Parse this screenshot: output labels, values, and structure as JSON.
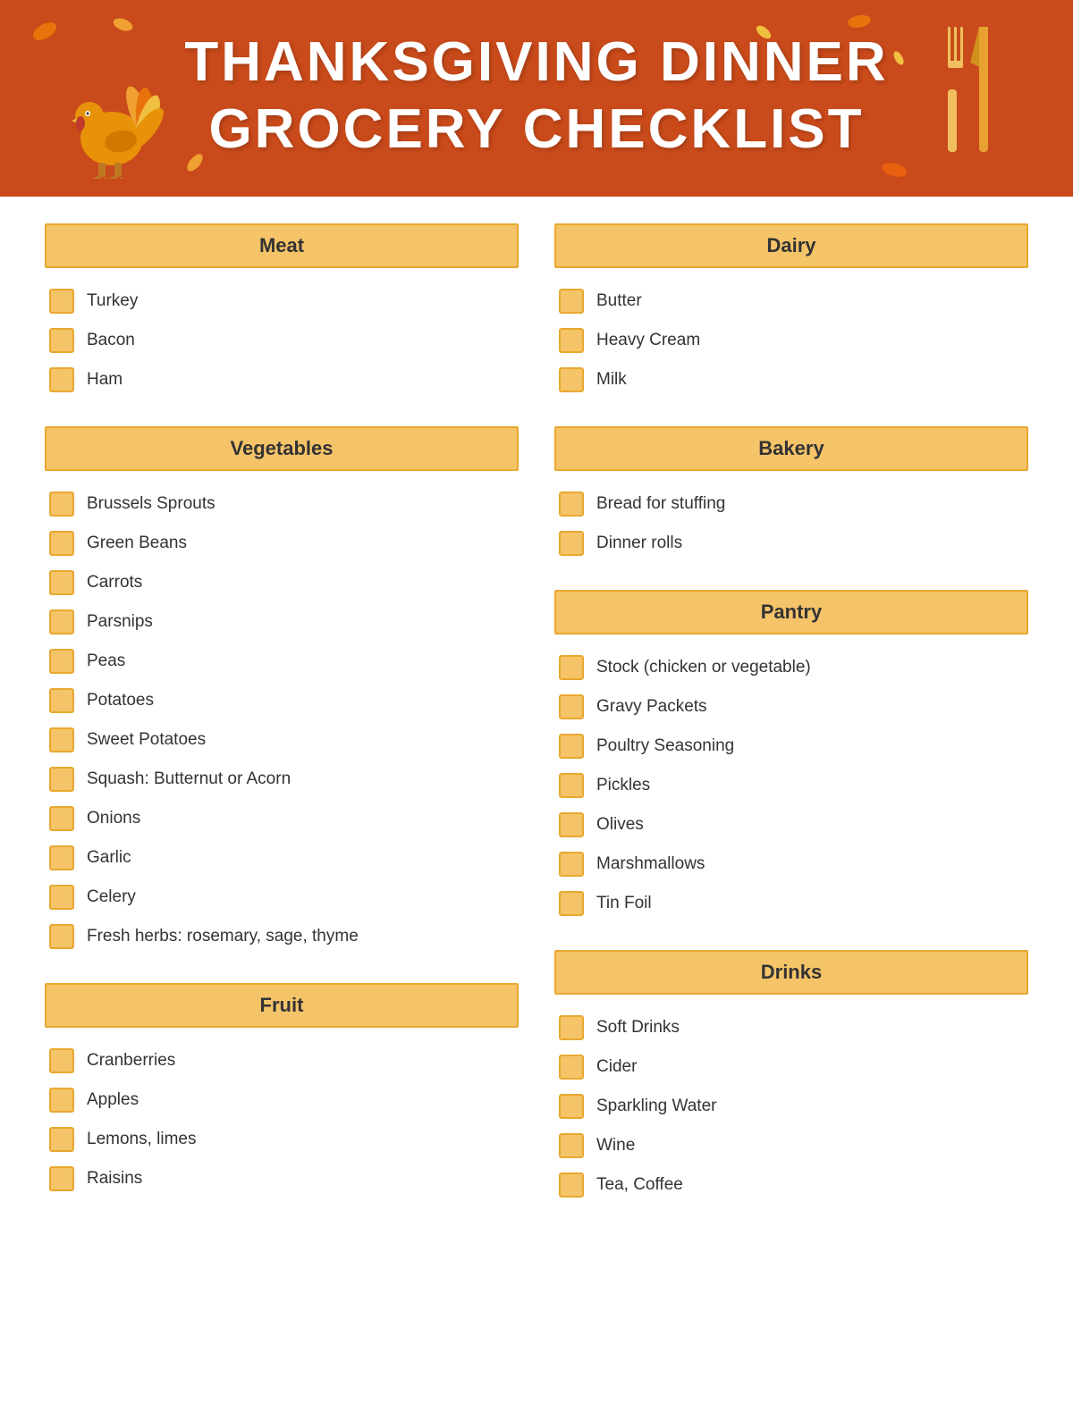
{
  "header": {
    "title_line1": "THANKSGIVING DINNER",
    "title_line2": "GROCERY CHECKLIST",
    "accent_color": "#c94a1a",
    "text_color": "#ffffff"
  },
  "sections": {
    "meat": {
      "label": "Meat",
      "items": [
        "Turkey",
        "Bacon",
        "Ham"
      ]
    },
    "dairy": {
      "label": "Dairy",
      "items": [
        "Butter",
        "Heavy Cream",
        "Milk"
      ]
    },
    "vegetables": {
      "label": "Vegetables",
      "items": [
        "Brussels Sprouts",
        "Green Beans",
        "Carrots",
        "Parsnips",
        "Peas",
        "Potatoes",
        "Sweet Potatoes",
        "Squash: Butternut or Acorn",
        "Onions",
        "Garlic",
        "Celery",
        "Fresh herbs: rosemary, sage, thyme"
      ]
    },
    "bakery": {
      "label": "Bakery",
      "items": [
        "Bread for stuffing",
        "Dinner rolls"
      ]
    },
    "pantry": {
      "label": "Pantry",
      "items": [
        "Stock (chicken or vegetable)",
        "Gravy Packets",
        "Poultry Seasoning",
        "Pickles",
        "Olives",
        "Marshmallows",
        "Tin Foil"
      ]
    },
    "fruit": {
      "label": "Fruit",
      "items": [
        "Cranberries",
        "Apples",
        "Lemons, limes",
        "Raisins"
      ]
    },
    "drinks": {
      "label": "Drinks",
      "items": [
        "Soft Drinks",
        "Cider",
        "Sparkling Water",
        "Wine",
        "Tea, Coffee"
      ]
    }
  }
}
